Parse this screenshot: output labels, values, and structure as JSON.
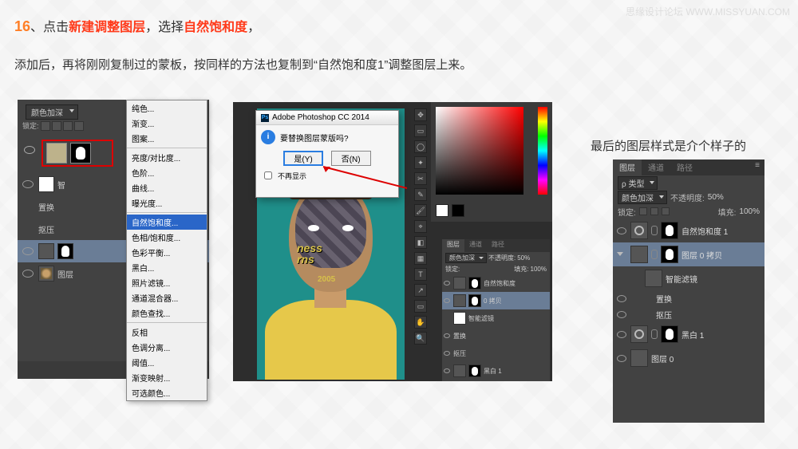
{
  "watermark": {
    "site": "思缘设计论坛",
    "url": "WWW.MISSYUAN.COM"
  },
  "heading": {
    "num": "16",
    "sep": "、",
    "p1a": "点击",
    "p1b": "新建调整图层",
    "p1c": "，选择",
    "p1d": "自然饱和度",
    "p1e": "，"
  },
  "para2": "添加后，再将刚刚复制过的蒙板，按同样的方法也复制到“自然饱和度1”调整图层上来。",
  "rightlabel": "最后的图层样式是介个样子的",
  "adjust_menu": {
    "grp1": [
      "纯色...",
      "渐变...",
      "图案..."
    ],
    "grp2": [
      "亮度/对比度...",
      "色阶...",
      "曲线...",
      "曝光度..."
    ],
    "selected": "自然饱和度...",
    "grp3": [
      "色相/饱和度...",
      "色彩平衡...",
      "黑白...",
      "照片滤镜...",
      "通道混合器...",
      "颜色查找..."
    ],
    "grp4": [
      "反相",
      "色调分离...",
      "阈值...",
      "渐变映射...",
      "可选颜色..."
    ]
  },
  "panel1": {
    "blend": "颜色加深",
    "lock_label": "锁定:",
    "layers": {
      "smart": "智",
      "replace": "置换",
      "extrude": "抠压",
      "base": "图层"
    }
  },
  "dialog": {
    "title": "Adobe Photoshop CC 2014",
    "message": "要替换图层蒙版吗?",
    "yes": "是(Y)",
    "no": "否(N)",
    "dontshow": "不再显示"
  },
  "canvas_text": {
    "l1": "ness",
    "l2": "rns",
    "year": "2005"
  },
  "mini": {
    "tabs": [
      "图层",
      "通道",
      "路径"
    ],
    "blend": "颜色加深",
    "opacity_label": "不透明度:",
    "opacity": "50%",
    "lock": "锁定:",
    "fill_label": "填充:",
    "fill": "100%",
    "layers": {
      "vibrance": "自然饱和度",
      "copy": "0 拷贝",
      "smart2": "智能滤镜",
      "replace": "置换",
      "extrude": "抠压",
      "bw": "黑白 1"
    }
  },
  "panel3": {
    "tabs": [
      "图层",
      "通道",
      "路径"
    ],
    "kind": "ρ 类型",
    "blend": "颜色加深",
    "opacity_label": "不透明度:",
    "opacity": "50%",
    "lock": "锁定:",
    "fill_label": "填充:",
    "fill": "100%",
    "layers": {
      "vibrance": "自然饱和度 1",
      "copy": "图层 0 拷贝",
      "smart": "智能滤镜",
      "replace": "置换",
      "extrude": "抠压",
      "bw": "黑白 1",
      "base": "图层 0"
    }
  }
}
